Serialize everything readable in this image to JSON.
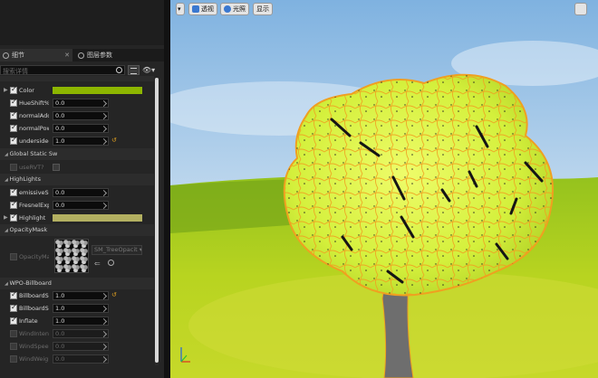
{
  "details": {
    "tab_details": "细节",
    "tab_layer_params": "图层参数",
    "search_placeholder": "搜索详情",
    "categories": {
      "opacity_mask": "OpacityMask",
      "global_static": "Global Static Sw",
      "highlights": "HighLights",
      "wpo_billboard": "WPO-Billboard"
    },
    "rows": {
      "color": {
        "label": "Color",
        "color": "#8db600"
      },
      "hue_shift": {
        "label": "HueShift%",
        "value": "0.0"
      },
      "normal_add": {
        "label": "normalAdd",
        "value": "0.0"
      },
      "normal_power": {
        "label": "normalPow",
        "value": "0.0"
      },
      "underside": {
        "label": "undersidec",
        "value": "1.0"
      },
      "use_rvt": {
        "label": "useRVT?"
      },
      "emissive": {
        "label": "emissiveSt",
        "value": "0.0"
      },
      "fresnel": {
        "label": "FresnelExp",
        "value": "0.0"
      },
      "highlight": {
        "label": "Highlight",
        "color": "#b3b061"
      },
      "opacity_mask_param": {
        "label": "OpacityMas"
      },
      "billboard_scale": {
        "label": "BillboardSc",
        "value": "1.0"
      },
      "billboard_size": {
        "label": "BillboardSiz",
        "value": "1.0"
      },
      "inflate": {
        "label": "Inflate",
        "value": "1.0"
      },
      "wind_intensity": {
        "label": "WindIntensi",
        "value": "0.0"
      },
      "wind_speed": {
        "label": "WindSpeed",
        "value": "0.0"
      },
      "wind_weight": {
        "label": "WindWeight",
        "value": "0.0"
      }
    },
    "texture_name": "SM_TreeOpacit"
  },
  "viewport": {
    "perspective_label": "透视",
    "lit_label": "光照",
    "show_label": "显示"
  },
  "colors": {
    "foliage": "#d8f040",
    "wireframe": "#f0a020",
    "sky": "#b8d8f0",
    "ground": "#86b820"
  }
}
